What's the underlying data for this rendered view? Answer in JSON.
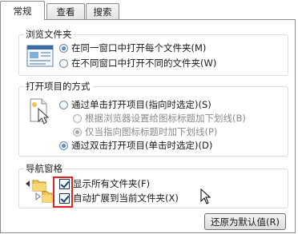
{
  "tabs": [
    {
      "label": "常规",
      "active": true
    },
    {
      "label": "查看",
      "active": false
    },
    {
      "label": "搜索",
      "active": false
    }
  ],
  "browse_folders": {
    "title": "浏览文件夹",
    "options": [
      {
        "label": "在同一窗口中打开每个文件夹(M)",
        "selected": true
      },
      {
        "label": "在不同窗口中打开不同的文件夹(W)",
        "selected": false
      }
    ]
  },
  "click_items": {
    "title": "打开项目的方式",
    "options": [
      {
        "label": "通过单击打开项目(指向时选定)(S)",
        "selected": false
      },
      {
        "label": "根据浏览器设置给图标标题加下划线(B)",
        "selected": false,
        "disabled": true
      },
      {
        "label": "仅当指向图标标题时加下划线(P)",
        "selected": true,
        "disabled": true
      },
      {
        "label": "通过双击打开项目(单击时选定)(D)",
        "selected": true
      }
    ]
  },
  "navigation_pane": {
    "title": "导航窗格",
    "options": [
      {
        "label": "显示所有文件夹(F)",
        "checked": true
      },
      {
        "label": "自动扩展到当前文件夹(X)",
        "checked": true
      }
    ]
  },
  "restore_defaults_label": "还原为默认值(R)",
  "colors": {
    "highlight": "#e32222",
    "border": "#8c8c8c"
  },
  "icons": [
    "browse-folders-icon",
    "click-items-icon",
    "navigation-pane-icon",
    "mouse-cursor-icon"
  ]
}
